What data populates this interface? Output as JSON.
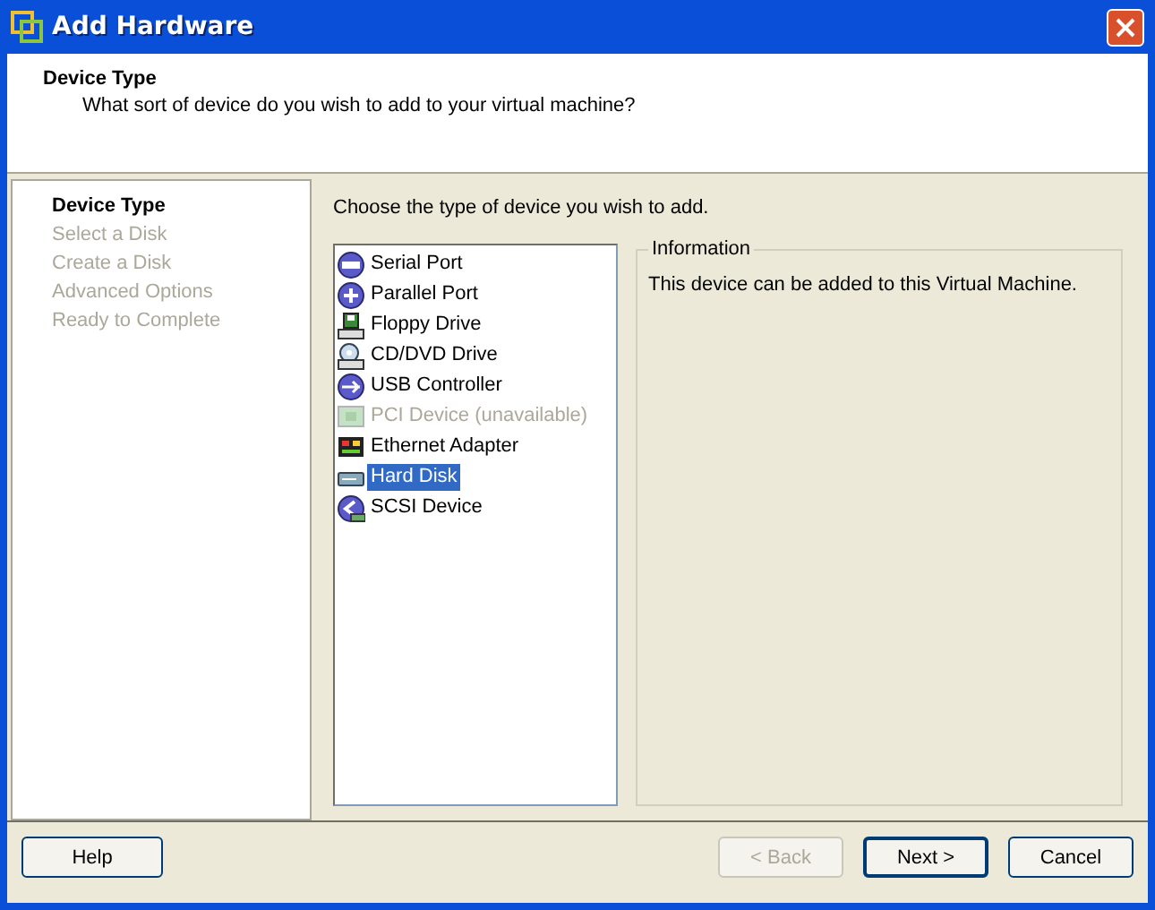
{
  "window": {
    "title": "Add Hardware"
  },
  "header": {
    "title": "Device Type",
    "subtitle": "What sort of device do you wish to add to your virtual machine?"
  },
  "steps": [
    {
      "label": "Device Type",
      "current": true
    },
    {
      "label": "Select a Disk",
      "current": false
    },
    {
      "label": "Create a Disk",
      "current": false
    },
    {
      "label": "Advanced Options",
      "current": false
    },
    {
      "label": "Ready to Complete",
      "current": false
    }
  ],
  "prompt": "Choose the type of device you wish to add.",
  "devices": [
    {
      "label": "Serial Port",
      "kind": "serial",
      "disabled": false,
      "selected": false
    },
    {
      "label": "Parallel Port",
      "kind": "parallel",
      "disabled": false,
      "selected": false
    },
    {
      "label": "Floppy Drive",
      "kind": "floppy",
      "disabled": false,
      "selected": false
    },
    {
      "label": "CD/DVD Drive",
      "kind": "cd",
      "disabled": false,
      "selected": false
    },
    {
      "label": "USB Controller",
      "kind": "usb",
      "disabled": false,
      "selected": false
    },
    {
      "label": "PCI Device (unavailable)",
      "kind": "pci",
      "disabled": true,
      "selected": false
    },
    {
      "label": "Ethernet Adapter",
      "kind": "ethernet",
      "disabled": false,
      "selected": false
    },
    {
      "label": "Hard Disk",
      "kind": "harddisk",
      "disabled": false,
      "selected": true
    },
    {
      "label": "SCSI Device",
      "kind": "scsi",
      "disabled": false,
      "selected": false
    }
  ],
  "information": {
    "title": "Information",
    "text": "This device can be added to this Virtual Machine."
  },
  "buttons": [
    {
      "label": "Help",
      "kind": "help",
      "disabled": false,
      "default": false
    },
    {
      "label": "< Back",
      "kind": "back",
      "disabled": true,
      "default": false
    },
    {
      "label": "Next >",
      "kind": "next",
      "disabled": false,
      "default": true
    },
    {
      "label": "Cancel",
      "kind": "cancel",
      "disabled": false,
      "default": false
    }
  ]
}
